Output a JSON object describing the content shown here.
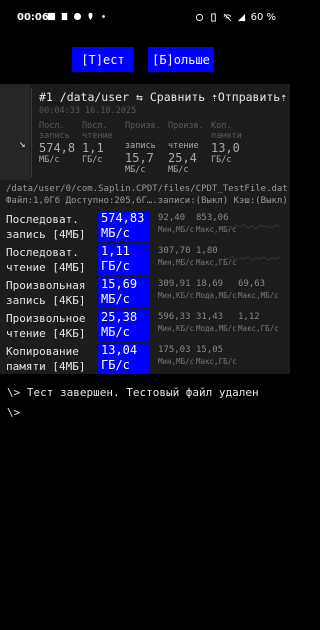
{
  "status_bar": {
    "time": "00:06",
    "battery": "60 %"
  },
  "toolbar": {
    "test_label": "[Т]ест",
    "more_label": "[Б]ольше"
  },
  "result": {
    "title": "#1 /data/user",
    "compare": "⇆ Сравнить",
    "send": "⇡Отправить⇡",
    "timestamp": "00:04:33 16.10.2025",
    "columns": [
      {
        "head": "Посл.\nзапись",
        "value": "574,8",
        "unit": "МБ/с"
      },
      {
        "head": "Посл.\nчтение",
        "value": "1,1",
        "unit": "ГБ/с"
      },
      {
        "head": "Произв.",
        "sub": "запись",
        "value": "15,7",
        "unit": "МБ/с"
      },
      {
        "head": "Произв.",
        "sub": "чтение",
        "value": "25,4",
        "unit": "МБ/с"
      },
      {
        "head": "Коп.\nпамяти",
        "value": "13,0",
        "unit": "ГБ/с"
      }
    ],
    "path": "/data/user/0/com.Saplin.CPDT/files/CPDT_TestFile.dat",
    "file_info": "Файл:1,0Гб Доступно:205,6Г….записи:(Выкл) Кэш:(Выкл)"
  },
  "rows": [
    {
      "label": "Последоват.\nзапись [4МБ]",
      "value": "574,83\nМБ/с",
      "s1": "92,40",
      "s1sub": "Мин,МБ/с",
      "s2": "853,06",
      "s2sub": "Макс,МБ/с",
      "s3": "",
      "s3sub": ""
    },
    {
      "label": "Последоват.\nчтение [4МБ]",
      "value": "1,11\nГБ/с",
      "s1": "307,70",
      "s1sub": "Мин,МБ/с",
      "s2": "1,80",
      "s2sub": "Макс,ГБ/с",
      "s3": "",
      "s3sub": ""
    },
    {
      "label": "Произвольная\nзапись [4КБ]",
      "value": "15,69\nМБ/с",
      "s1": "309,91",
      "s1sub": "Мин,КБ/с",
      "s2": "18,69",
      "s2sub": "Мода,МБ/с",
      "s3": "69,63",
      "s3sub": "Макс,МБ/с"
    },
    {
      "label": "Произвольное\nчтение [4КБ]",
      "value": "25,38\nМБ/с",
      "s1": "596,33",
      "s1sub": "Мин,КБ/с",
      "s2": "31,43",
      "s2sub": "Мода,МБ/с",
      "s3": "1,12",
      "s3sub": "Макс,ГБ/с"
    },
    {
      "label": "Копирование\nпамяти [4МБ]",
      "value": "13,04\nГБ/с",
      "s1": "175,03",
      "s1sub": "Мин,МБ/с",
      "s2": "15,05",
      "s2sub": "Макс,ГБ/с",
      "s3": "",
      "s3sub": ""
    }
  ],
  "console": {
    "line1": "\\> Тест завершен. Тестовый файл удален",
    "line2": "\\>"
  },
  "colors": {
    "accent": "#0000ff",
    "panel": "#1c1c1c"
  }
}
